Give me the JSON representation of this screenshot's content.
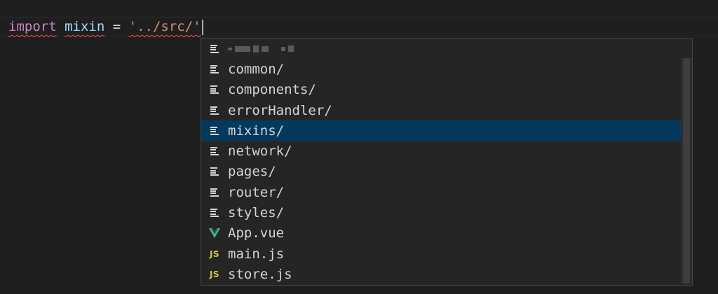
{
  "editor": {
    "tokens": {
      "keyword": "import",
      "identifier": "mixin",
      "operator": "=",
      "string": "'../src/'"
    }
  },
  "suggest": {
    "items": [
      {
        "label": "",
        "icon": "file-lines-icon",
        "blurred": true
      },
      {
        "label": "common/",
        "icon": "file-lines-icon"
      },
      {
        "label": "components/",
        "icon": "file-lines-icon"
      },
      {
        "label": "errorHandler/",
        "icon": "file-lines-icon"
      },
      {
        "label": "mixins/",
        "icon": "file-lines-icon",
        "selected": true
      },
      {
        "label": "network/",
        "icon": "file-lines-icon"
      },
      {
        "label": "pages/",
        "icon": "file-lines-icon"
      },
      {
        "label": "router/",
        "icon": "file-lines-icon"
      },
      {
        "label": "styles/",
        "icon": "file-lines-icon"
      },
      {
        "label": "App.vue",
        "icon": "vue-icon"
      },
      {
        "label": "main.js",
        "icon": "js-icon",
        "icon_text": "JS"
      },
      {
        "label": "store.js",
        "icon": "js-icon",
        "icon_text": "JS"
      }
    ]
  },
  "colors": {
    "background": "#1e1e1e",
    "selection": "#04395e",
    "keyword": "#c586c0",
    "identifier": "#9cdcfe",
    "string": "#ce9178",
    "error_squiggle": "#f14c4c",
    "vue_green": "#41b883",
    "js_yellow": "#cbcb41"
  }
}
